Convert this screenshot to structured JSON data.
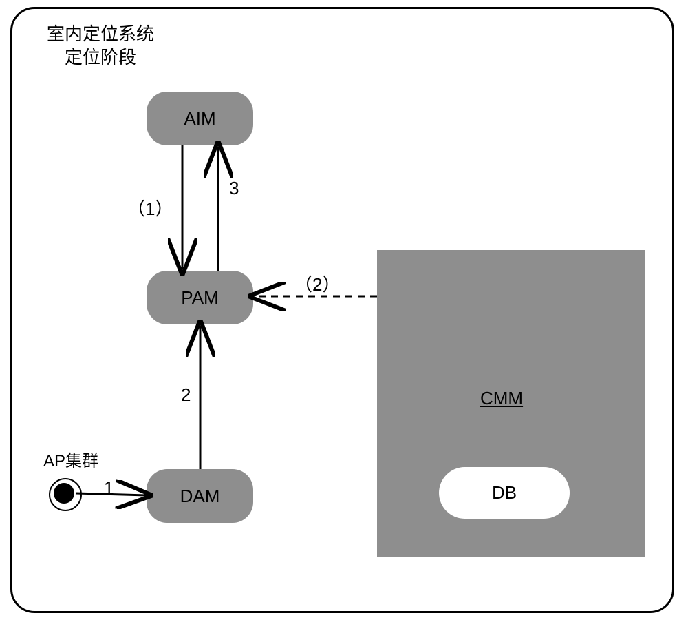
{
  "title": {
    "line1": "室内定位系统",
    "line2": "定位阶段"
  },
  "nodes": {
    "aim": "AIM",
    "pam": "PAM",
    "dam": "DAM",
    "cmm": "CMM",
    "db": "DB"
  },
  "labels": {
    "ap_cluster": "AP集群",
    "edge_1": "1",
    "edge_2": "2",
    "edge_3": "3",
    "edge_p1": "（1）",
    "edge_p2": "（2）"
  },
  "chart_data": {
    "type": "diagram",
    "title": "室内定位系统 定位阶段",
    "nodes": [
      {
        "id": "AP",
        "label": "AP集群",
        "kind": "source"
      },
      {
        "id": "DAM",
        "label": "DAM",
        "kind": "module"
      },
      {
        "id": "PAM",
        "label": "PAM",
        "kind": "module"
      },
      {
        "id": "AIM",
        "label": "AIM",
        "kind": "module"
      },
      {
        "id": "CMM",
        "label": "CMM",
        "kind": "subsystem"
      },
      {
        "id": "DB",
        "label": "DB",
        "kind": "datastore",
        "parent": "CMM"
      }
    ],
    "edges": [
      {
        "from": "AP",
        "to": "DAM",
        "label": "1",
        "style": "solid"
      },
      {
        "from": "DAM",
        "to": "PAM",
        "label": "2",
        "style": "solid"
      },
      {
        "from": "PAM",
        "to": "AIM",
        "label": "3",
        "style": "solid"
      },
      {
        "from": "AIM",
        "to": "PAM",
        "label": "（1）",
        "style": "solid"
      },
      {
        "from": "CMM",
        "to": "PAM",
        "label": "（2）",
        "style": "dashed"
      }
    ]
  }
}
